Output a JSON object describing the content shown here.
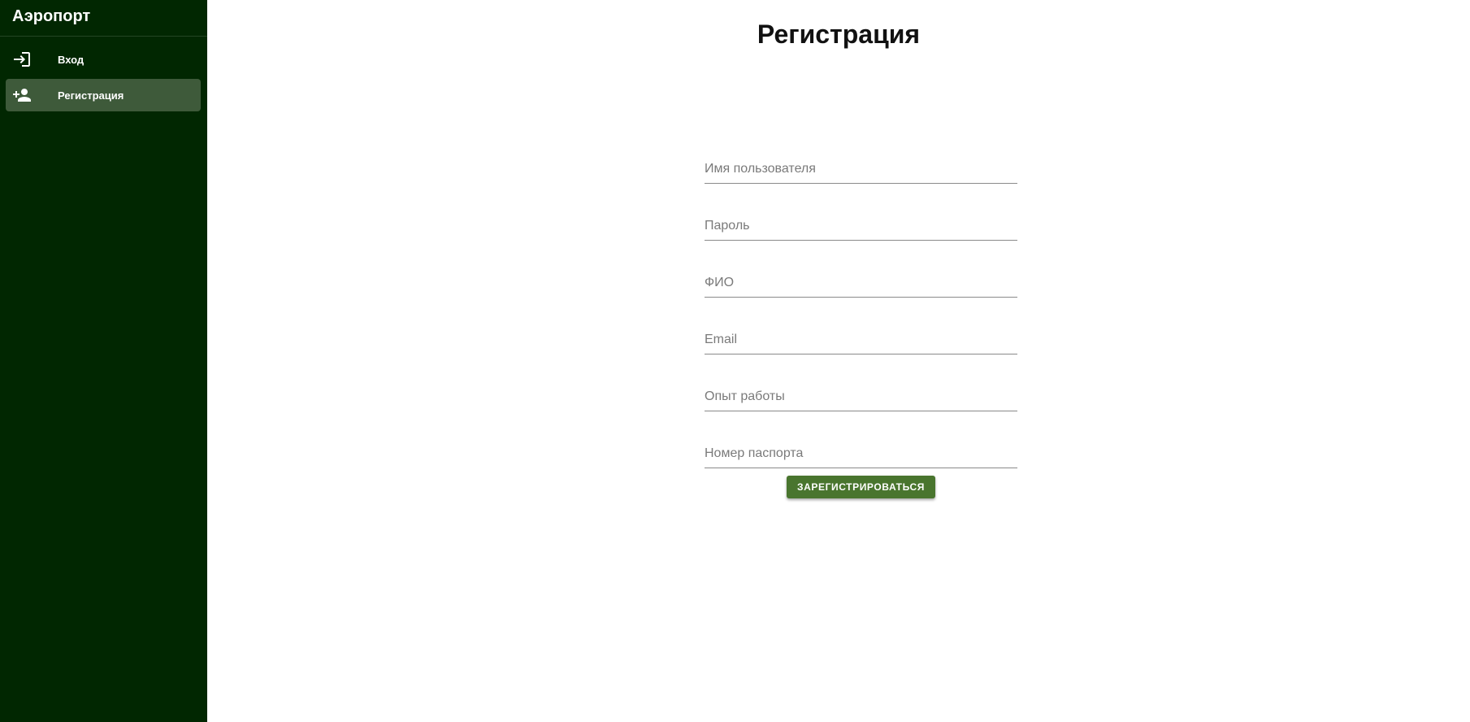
{
  "sidebar": {
    "title": "Аэропорт",
    "items": [
      {
        "label": "Вход",
        "icon": "login-icon",
        "active": false
      },
      {
        "label": "Регистрация",
        "icon": "person-add-icon",
        "active": true
      }
    ]
  },
  "main": {
    "title": "Регистрация",
    "fields": {
      "username": {
        "placeholder": "Имя пользователя",
        "value": ""
      },
      "password": {
        "placeholder": "Пароль",
        "value": ""
      },
      "fullname": {
        "placeholder": "ФИО",
        "value": ""
      },
      "email": {
        "placeholder": "Email",
        "value": ""
      },
      "experience": {
        "placeholder": "Опыт работы",
        "value": ""
      },
      "passport": {
        "placeholder": "Номер паспорта",
        "value": ""
      }
    },
    "submit_label": "ЗАРЕГИСТРИРОВАТЬСЯ"
  },
  "colors": {
    "sidebar_bg": "#012701",
    "active_item_bg": "#3e5a3a",
    "button_bg": "#49752e"
  }
}
